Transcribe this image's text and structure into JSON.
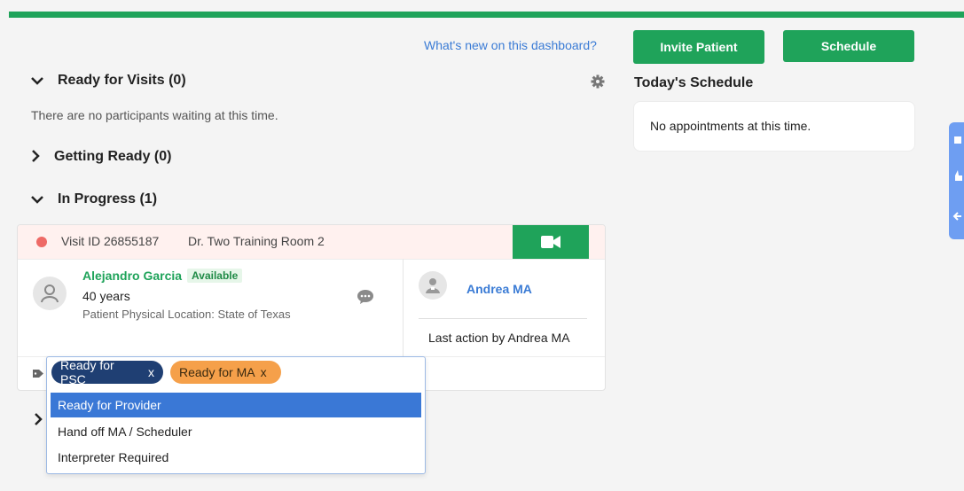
{
  "header": {
    "whats_new_link": "What's new on this dashboard?",
    "invite_button": "Invite Patient",
    "schedule_button": "Schedule"
  },
  "sections": {
    "ready_for_visits": {
      "label": "Ready for Visits (0)",
      "empty_text": "There are no participants waiting at this time."
    },
    "getting_ready": {
      "label": "Getting Ready (0)"
    },
    "in_progress": {
      "label": "In Progress (1)"
    }
  },
  "visit": {
    "visit_id": "Visit ID 26855187",
    "room": "Dr. Two Training Room 2",
    "patient_name": "Alejandro Garcia",
    "status_badge": "Available",
    "age": "40 years",
    "location": "Patient Physical Location: State of Texas",
    "provider_name": "Andrea MA",
    "last_action": "Last action by Andrea MA",
    "tags": [
      {
        "label": "Ready for PSC",
        "remove": "x",
        "color": "#1f3f73"
      },
      {
        "label": "Ready for MA",
        "remove": "x",
        "color": "#f5a04a"
      }
    ]
  },
  "dropdown": {
    "options": [
      "Ready for Provider",
      "Hand off MA / Scheduler",
      "Interpreter Required"
    ],
    "selected_index": 0
  },
  "schedule": {
    "title": "Today's Schedule",
    "empty_text": "No appointments at this time."
  },
  "icons": [
    "gear-icon",
    "video-icon",
    "user-icon",
    "chat-icon",
    "provider-icon",
    "tag-icon",
    "chevron-down-icon",
    "chevron-right-icon"
  ],
  "colors": {
    "accent": "#1fa35a",
    "link": "#3a7bd5",
    "selected": "#3a78d6",
    "psc_tag": "#1f3f73",
    "ma_tag": "#f5a04a"
  }
}
